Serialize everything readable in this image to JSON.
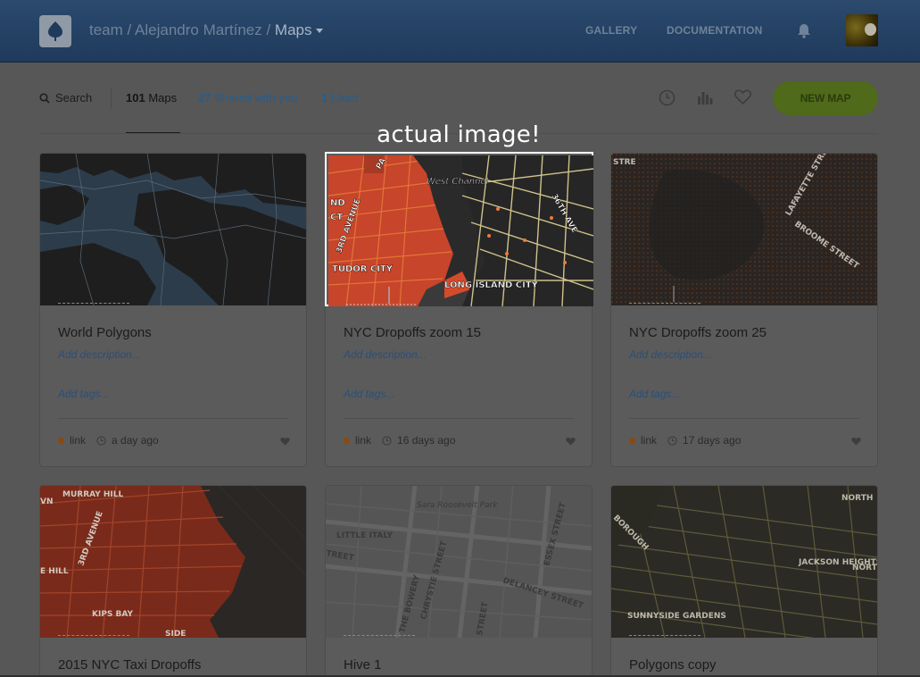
{
  "header": {
    "breadcrumb_team": "team /",
    "breadcrumb_user": "Alejandro Martínez /",
    "breadcrumb_current": "Maps",
    "nav": [
      "GALLERY",
      "DOCUMENTATION"
    ]
  },
  "toolbar": {
    "search_label": "Search",
    "tabs": [
      {
        "count": "101",
        "label": "Maps"
      },
      {
        "count": "27",
        "label": "Shared with you"
      },
      {
        "count": "1",
        "label": "Liked"
      }
    ],
    "new_map_label": "NEW MAP"
  },
  "annotation": "actual image!",
  "cards": [
    {
      "title": "World Polygons",
      "description": "Add description...",
      "tags": "Add tags...",
      "privacy": "link",
      "updated": "a day ago"
    },
    {
      "title": "NYC Dropoffs zoom 15",
      "description": "Add description...",
      "tags": "Add tags...",
      "privacy": "link",
      "updated": "16 days ago"
    },
    {
      "title": "NYC Dropoffs zoom 25",
      "description": "Add description...",
      "tags": "Add tags...",
      "privacy": "link",
      "updated": "17 days ago"
    },
    {
      "title": "2015 NYC Taxi Dropoffs"
    },
    {
      "title": "Hive 1"
    },
    {
      "title": "Polygons copy"
    }
  ],
  "map_labels": {
    "card2": [
      "West Channel",
      "36TH AVE",
      "3RD AVENUE",
      "TUDOR CITY",
      "LONG ISLAND CITY",
      "ND",
      "CT",
      "PA"
    ],
    "card3": [
      "LAFAYETTE STREET",
      "BROOME STREET",
      "STRE"
    ],
    "card4": [
      "MURRAY HILL",
      "3RD AVENUE",
      "E HILL",
      "KIPS BAY",
      "VN",
      "SIDE"
    ],
    "card5": [
      "Sara Roosevelt Park",
      "LITTLE ITALY",
      "TREET",
      "ESSEX STREET",
      "DELANCEY STREET",
      "THE BOWERY",
      "CHRYSTIE STREET",
      "STREET"
    ],
    "card6": [
      "NORTH",
      "JACKSON HEIGHTS",
      "NORT",
      "SUNNYSIDE GARDENS",
      "BOROUGH"
    ]
  },
  "colors": {
    "accent_button": "#4e6a1a",
    "header": "#1f3a5c",
    "link": "#275d8c",
    "privacy_dot": "#8a4a0c"
  },
  "icons": [
    "map-logo-icon",
    "bell-icon",
    "search-icon",
    "clock-icon",
    "bar-chart-icon",
    "heart-icon"
  ]
}
